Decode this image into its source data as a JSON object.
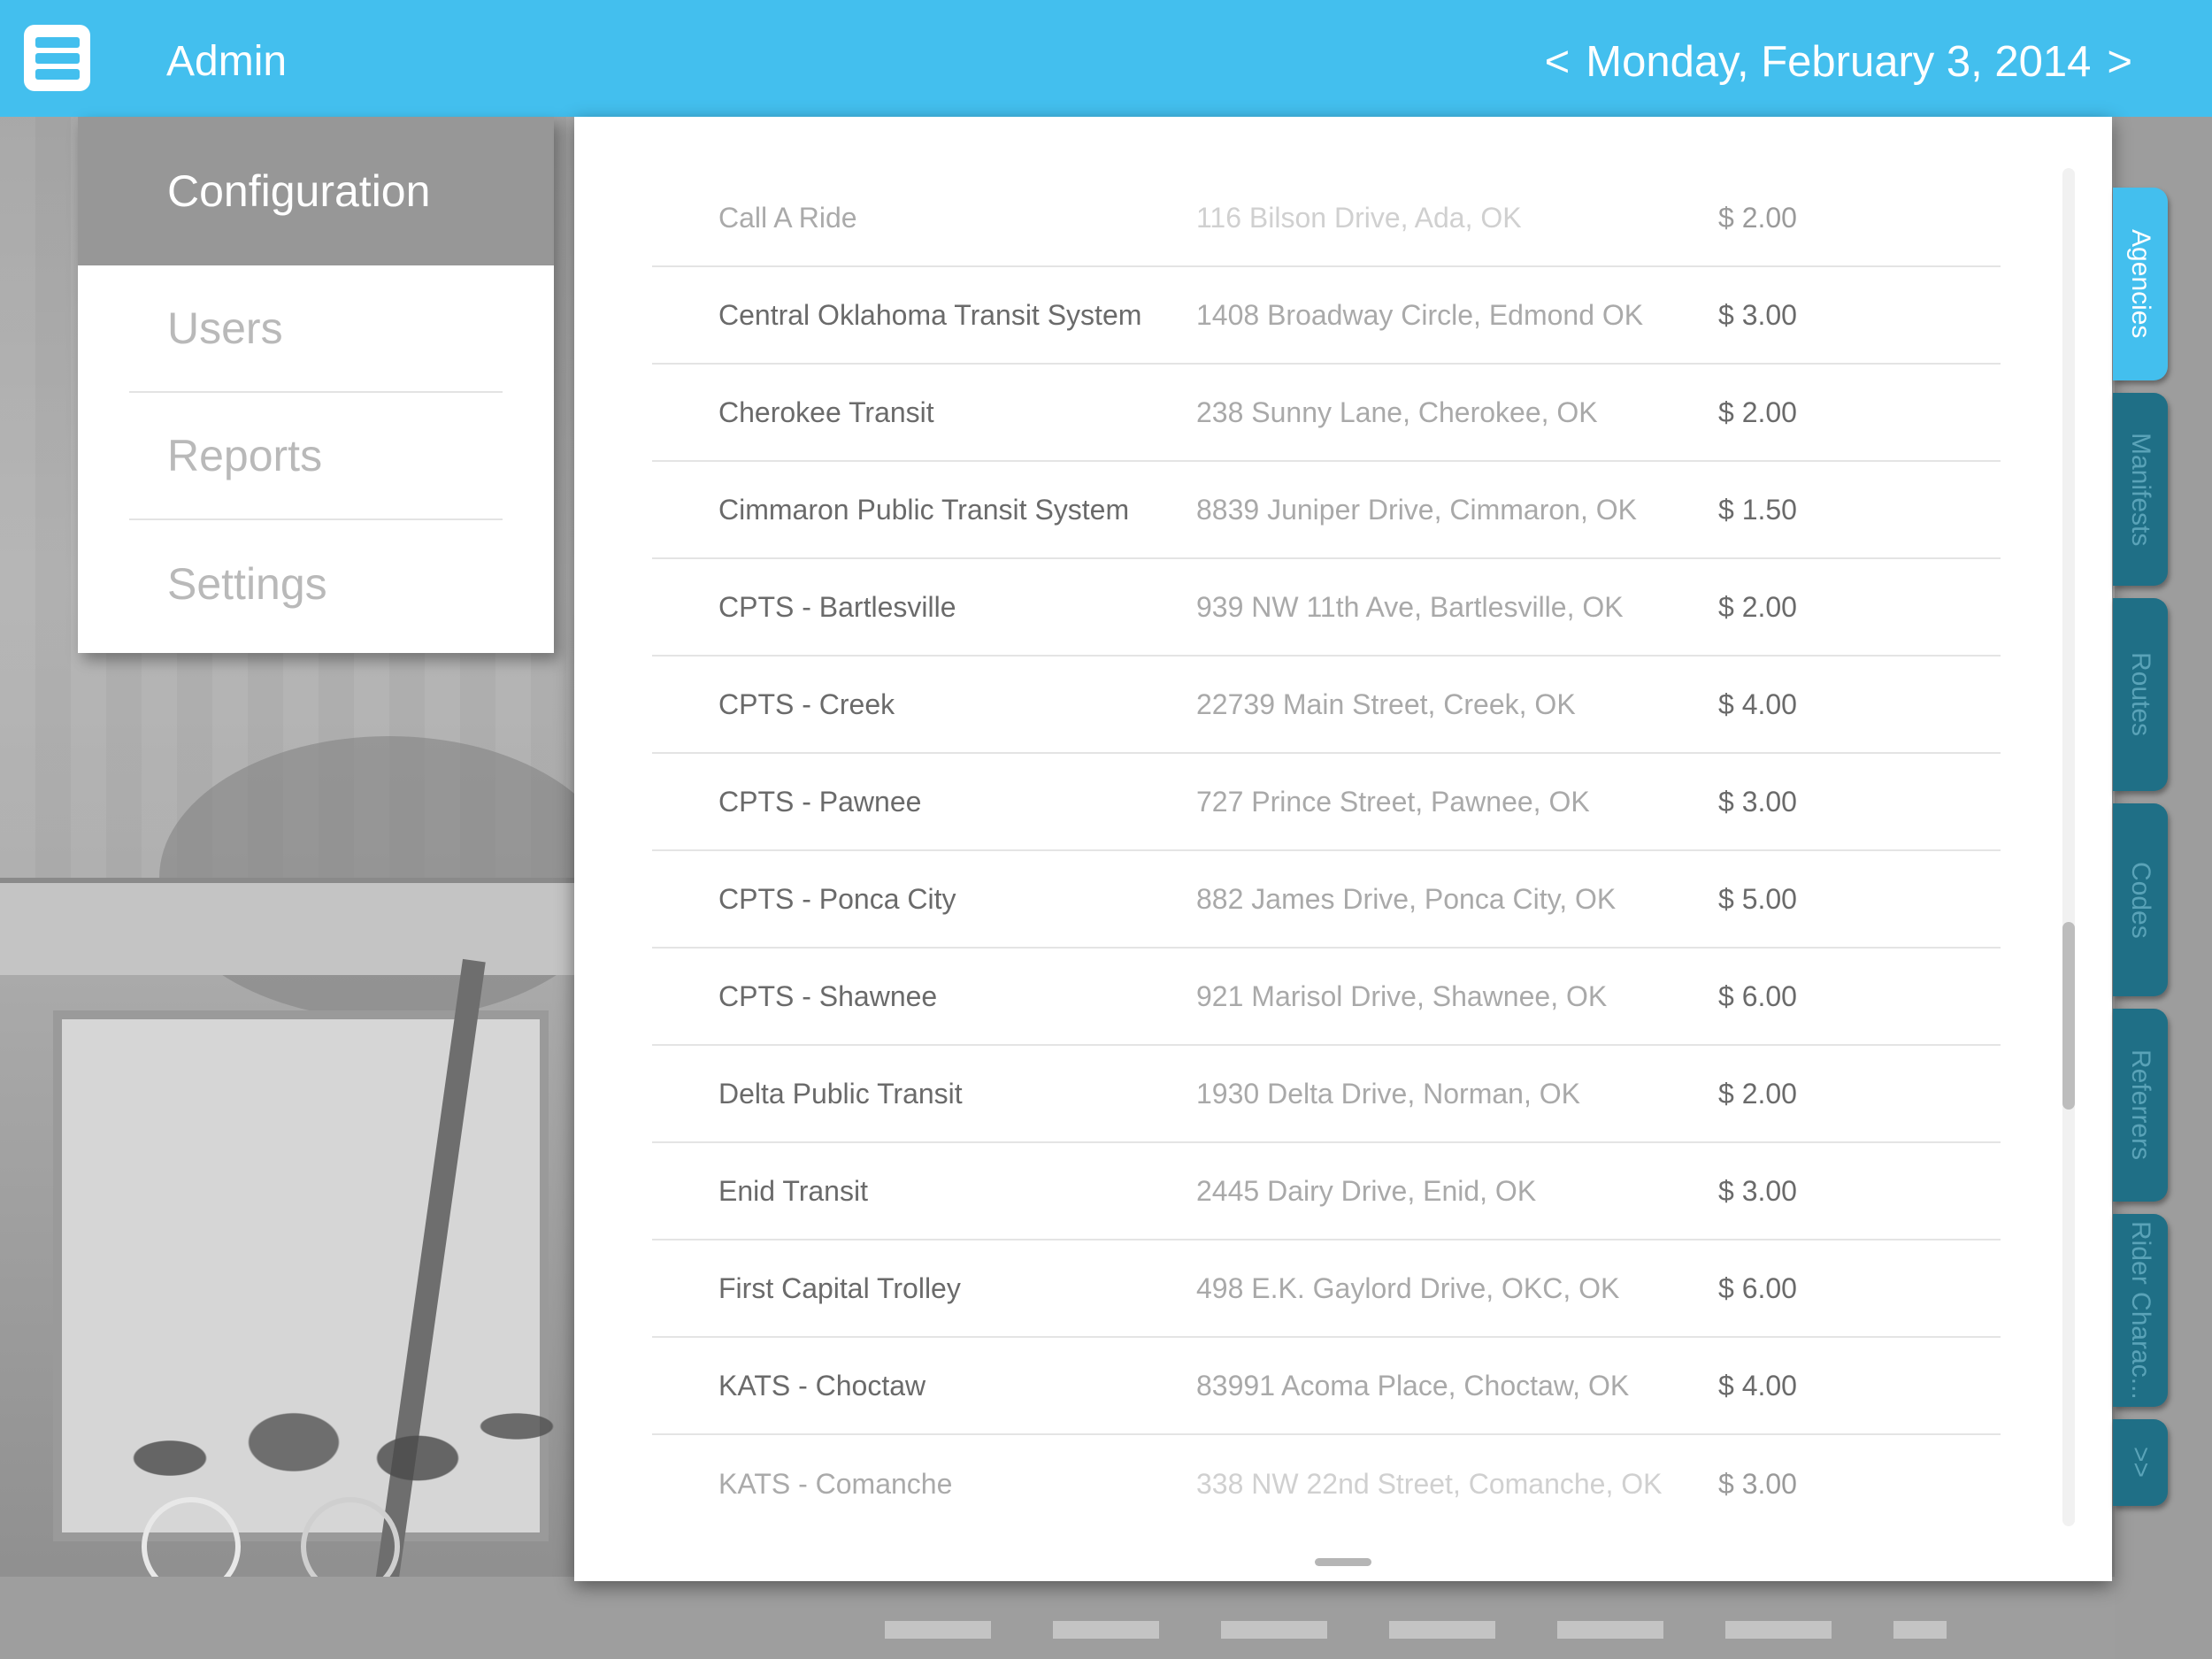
{
  "header": {
    "title": "Admin",
    "date_prev": "<",
    "date": "Monday, February 3, 2014",
    "date_next": ">"
  },
  "side_menu": {
    "active": "Configuration",
    "items": [
      "Users",
      "Reports",
      "Settings"
    ]
  },
  "agencies": [
    {
      "name": "Call A Ride",
      "address": "116 Bilson Drive, Ada, OK",
      "fare": "$ 2.00"
    },
    {
      "name": "Central Oklahoma Transit System",
      "address": "1408 Broadway Circle, Edmond OK",
      "fare": "$ 3.00"
    },
    {
      "name": "Cherokee Transit",
      "address": "238 Sunny Lane, Cherokee, OK",
      "fare": "$ 2.00"
    },
    {
      "name": "Cimmaron Public Transit System",
      "address": "8839 Juniper Drive, Cimmaron, OK",
      "fare": "$ 1.50"
    },
    {
      "name": "CPTS - Bartlesville",
      "address": "939 NW 11th Ave, Bartlesville, OK",
      "fare": "$ 2.00"
    },
    {
      "name": "CPTS - Creek",
      "address": "22739 Main Street, Creek, OK",
      "fare": "$ 4.00"
    },
    {
      "name": "CPTS - Pawnee",
      "address": "727 Prince Street, Pawnee, OK",
      "fare": "$ 3.00"
    },
    {
      "name": "CPTS - Ponca City",
      "address": "882 James Drive, Ponca City, OK",
      "fare": "$ 5.00"
    },
    {
      "name": "CPTS - Shawnee",
      "address": "921 Marisol Drive, Shawnee, OK",
      "fare": "$ 6.00"
    },
    {
      "name": "Delta Public Transit",
      "address": "1930 Delta Drive, Norman, OK",
      "fare": "$ 2.00"
    },
    {
      "name": "Enid Transit",
      "address": "2445 Dairy Drive, Enid, OK",
      "fare": "$ 3.00"
    },
    {
      "name": "First Capital Trolley",
      "address": "498 E.K. Gaylord Drive, OKC, OK",
      "fare": "$ 6.00"
    },
    {
      "name": "KATS - Choctaw",
      "address": "83991 Acoma Place, Choctaw, OK",
      "fare": "$ 4.00"
    },
    {
      "name": "KATS - Comanche",
      "address": "338 NW 22nd Street, Comanche, OK",
      "fare": "$ 3.00"
    }
  ],
  "tabs": [
    "Agencies",
    "Manifests",
    "Routes",
    "Codes",
    "Referrers",
    "Rider Charac...",
    ">>"
  ],
  "colors": {
    "accent": "#43bfee",
    "tab_inactive": "#1f6f86"
  }
}
